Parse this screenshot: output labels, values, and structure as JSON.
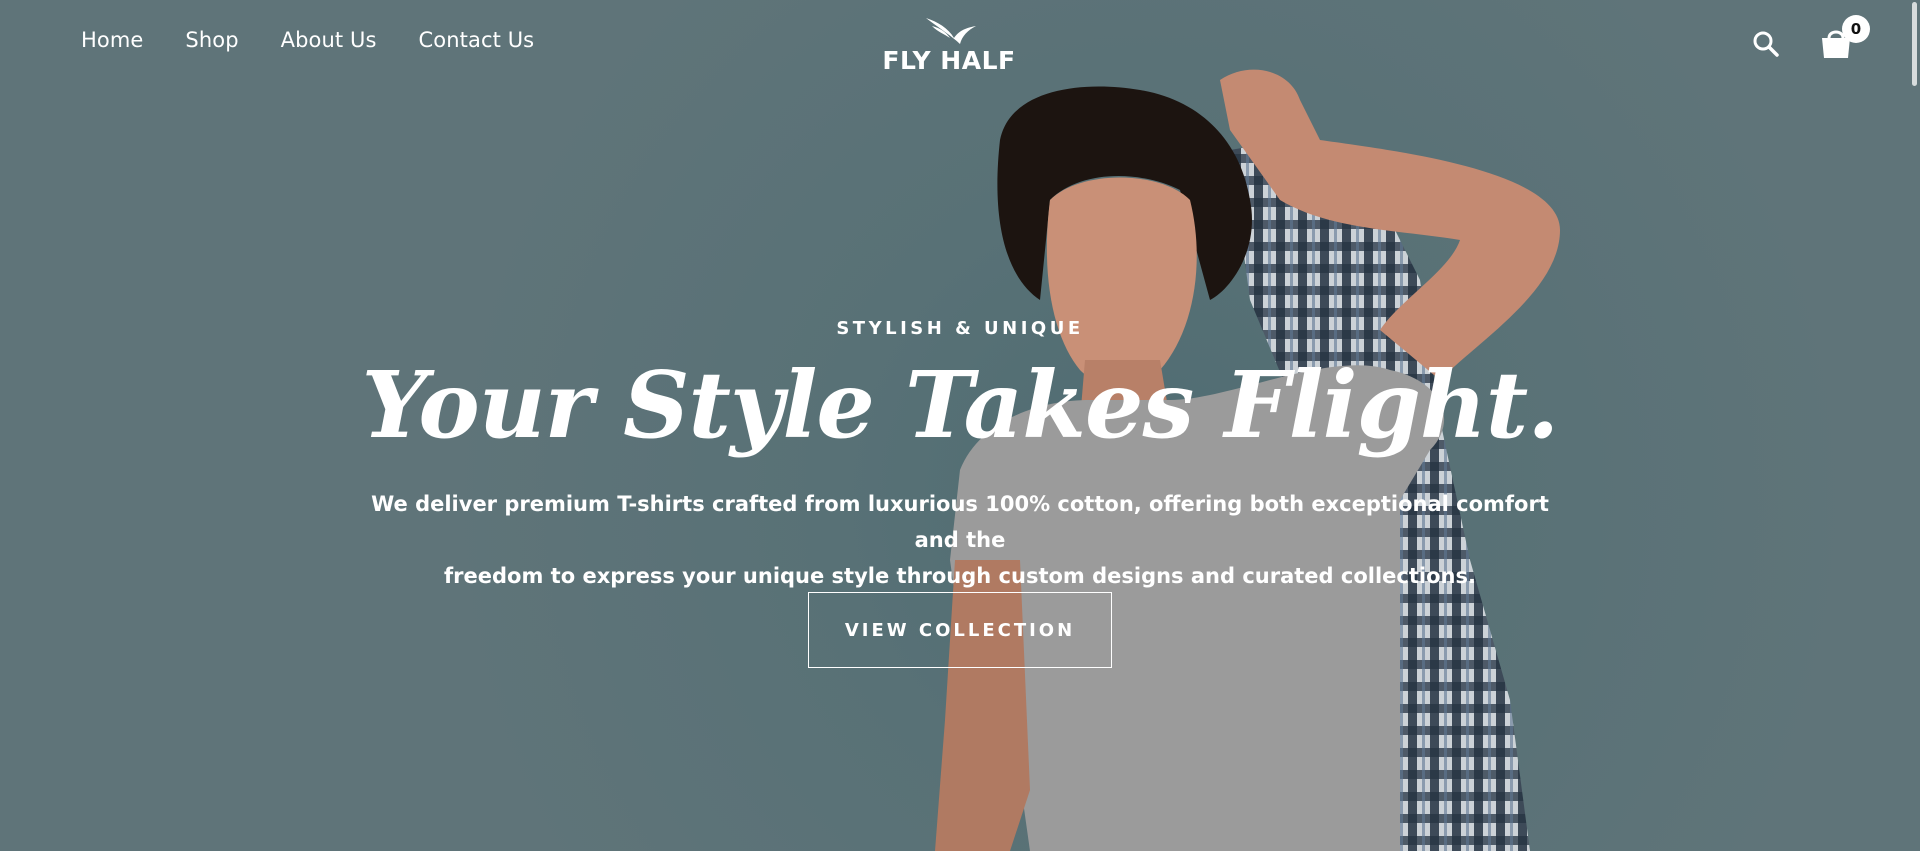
{
  "brand": {
    "name": "FLY HALF"
  },
  "nav": {
    "items": [
      {
        "label": "Home"
      },
      {
        "label": "Shop"
      },
      {
        "label": "About Us"
      },
      {
        "label": "Contact Us"
      }
    ]
  },
  "header": {
    "search_icon": "search-icon",
    "cart_icon": "shopping-bag-icon",
    "cart_count": "0"
  },
  "hero": {
    "eyebrow": "STYLISH & UNIQUE",
    "headline": "Your Style Takes Flight.",
    "description_line1": "We deliver premium T-shirts crafted from luxurious 100% cotton, offering both exceptional comfort and the",
    "description_line2": "freedom to express your unique style through custom designs and curated collections.",
    "cta_label": "VIEW COLLECTION"
  },
  "colors": {
    "background": "#5d7277",
    "text": "#ffffff"
  }
}
